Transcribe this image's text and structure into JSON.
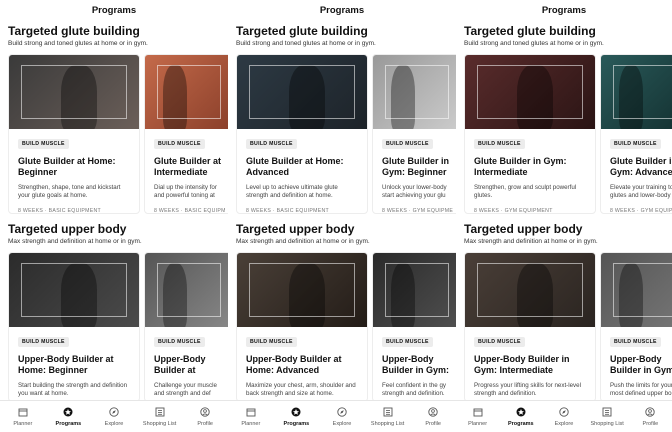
{
  "header": {
    "title": "Programs"
  },
  "colors": {
    "active": "#111111",
    "inactive": "#555555",
    "badge_bg": "#ececec"
  },
  "panels": [
    {
      "sections": [
        {
          "title": "Targeted glute building",
          "subtitle": "Build strong and toned glutes at home or in gym.",
          "cards": [
            {
              "badge": "BUILD MUSCLE",
              "title": "Glute Builder at Home: Beginner",
              "desc": "Strengthen, shape, tone and kickstart your glute goals at home.",
              "meta": "8 WEEKS · BASIC EQUIPMENT"
            },
            {
              "badge": "BUILD MUSCLE",
              "title": "Glute Builder at Intermediate",
              "desc": "Dial up the intensity for and powerful toning at",
              "meta": "8 WEEKS · BASIC EQUIPME"
            }
          ]
        },
        {
          "title": "Targeted upper body",
          "subtitle": "Max strength and definition at home or in gym.",
          "cards": [
            {
              "badge": "BUILD MUSCLE",
              "title": "Upper-Body Builder at Home: Beginner",
              "desc": "Start building the strength and definition you want at home.",
              "meta": ""
            },
            {
              "badge": "BUILD MUSCLE",
              "title": "Upper-Body Builder at Home: Intermed",
              "desc": "Challenge your muscle and strength and def",
              "meta": ""
            }
          ]
        }
      ]
    },
    {
      "sections": [
        {
          "title": "Targeted glute building",
          "subtitle": "Build strong and toned glutes at home or in gym.",
          "cards": [
            {
              "badge": "BUILD MUSCLE",
              "title": "Glute Builder at Home: Advanced",
              "desc": "Level up to achieve ultimate glute strength and definition at home.",
              "meta": "8 WEEKS · BASIC EQUIPMENT"
            },
            {
              "badge": "BUILD MUSCLE",
              "title": "Glute Builder in Gym: Beginner",
              "desc": "Unlock your lower-body start achieving your glu",
              "meta": "8 WEEKS · GYM EQUIPME"
            }
          ]
        },
        {
          "title": "Targeted upper body",
          "subtitle": "Max strength and definition at home or in gym.",
          "cards": [
            {
              "badge": "BUILD MUSCLE",
              "title": "Upper-Body Builder at Home: Advanced",
              "desc": "Maximize your chest, arm, shoulder and back strength and size at home.",
              "meta": ""
            },
            {
              "badge": "BUILD MUSCLE",
              "title": "Upper-Body Builder in Gym: Beginner",
              "desc": "Feel confident in the gy strength and definition.",
              "meta": ""
            }
          ]
        }
      ]
    },
    {
      "sections": [
        {
          "title": "Targeted glute building",
          "subtitle": "Build strong and toned glutes at home or in gym.",
          "cards": [
            {
              "badge": "BUILD MUSCLE",
              "title": "Glute Builder in Gym: Intermediate",
              "desc": "Strengthen, grow and sculpt powerful glutes.",
              "meta": "8 WEEKS · GYM EQUIPMENT"
            },
            {
              "badge": "BUILD MUSCLE",
              "title": "Glute Builder in Gym: Advanced",
              "desc": "Elevate your training to s glutes and lower-body",
              "meta": "8 WEEKS · GYM EQUIPME"
            }
          ]
        },
        {
          "title": "Targeted upper body",
          "subtitle": "Max strength and definition at home or in gym.",
          "cards": [
            {
              "badge": "BUILD MUSCLE",
              "title": "Upper-Body Builder in Gym: Intermediate",
              "desc": "Progress your lifting skills for next-level strength and definition.",
              "meta": ""
            },
            {
              "badge": "BUILD MUSCLE",
              "title": "Upper-Body Builder in Gym: Advanced",
              "desc": "Push the limits for your most defined upper bo",
              "meta": ""
            }
          ]
        }
      ]
    }
  ],
  "nav": [
    {
      "label": "Planner",
      "icon": "calendar-icon"
    },
    {
      "label": "Programs",
      "icon": "star-icon",
      "active": true
    },
    {
      "label": "Explore",
      "icon": "compass-icon"
    },
    {
      "label": "Shopping List",
      "icon": "list-icon"
    },
    {
      "label": "Profile",
      "icon": "profile-icon"
    }
  ]
}
